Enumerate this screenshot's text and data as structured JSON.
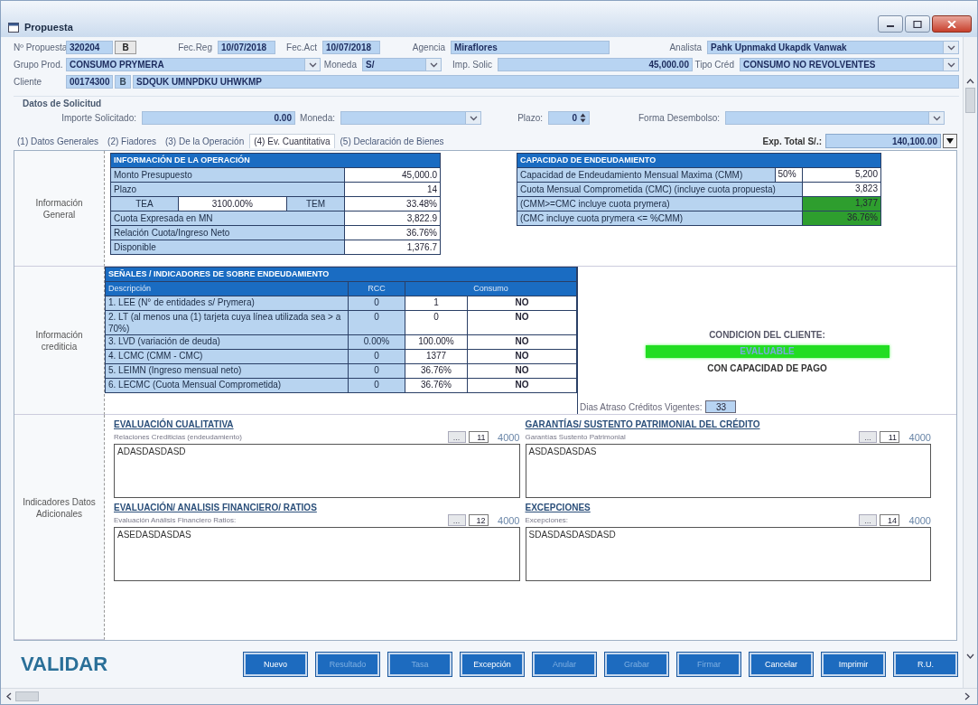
{
  "window": {
    "title": "Propuesta"
  },
  "header_rows": [
    [
      {
        "kind": "label",
        "text": "Nº Propuesta"
      },
      {
        "kind": "field",
        "text": "320204"
      },
      {
        "kind": "button",
        "text": "B"
      },
      {
        "kind": "label",
        "text": "Fec.Reg"
      },
      {
        "kind": "field",
        "text": "10/07/2018"
      },
      {
        "kind": "label",
        "text": "Fec.Act"
      },
      {
        "kind": "field",
        "text": "10/07/2018"
      },
      {
        "kind": "label",
        "text": "Agencia"
      },
      {
        "kind": "field",
        "text": "Miraflores"
      },
      {
        "kind": "label",
        "text": "Analista"
      },
      {
        "kind": "select",
        "text": "Pahk Upnmakd Ukapdk Vanwak"
      }
    ],
    [
      {
        "kind": "label",
        "text": "Grupo Prod."
      },
      {
        "kind": "select",
        "text": "CONSUMO PRYMERA"
      },
      {
        "kind": "label",
        "text": "Moneda"
      },
      {
        "kind": "select",
        "text": "S/"
      },
      {
        "kind": "label",
        "text": "Imp. Solic"
      },
      {
        "kind": "number",
        "text": "45,000.00"
      },
      {
        "kind": "label",
        "text": "Tipo Créd"
      },
      {
        "kind": "select",
        "text": "CONSUMO NO REVOLVENTES"
      }
    ],
    [
      {
        "kind": "label",
        "text": "Cliente"
      },
      {
        "kind": "field",
        "text": "00174300"
      },
      {
        "kind": "button",
        "text": "B"
      },
      {
        "kind": "field",
        "text": "SDQUK UMNPDKU UHWKMP"
      }
    ]
  ],
  "solicitud": {
    "title": "Datos de Solicitud",
    "items": [
      {
        "kind": "label",
        "text": "Importe Solicitado:"
      },
      {
        "kind": "number",
        "text": "0.00"
      },
      {
        "kind": "label",
        "text": "Moneda:"
      },
      {
        "kind": "select"
      },
      {
        "kind": "label",
        "text": "Plazo:"
      },
      {
        "kind": "spinner",
        "text": "0"
      },
      {
        "kind": "label",
        "text": "Forma Desembolso:"
      },
      {
        "kind": "select"
      }
    ]
  },
  "tabs": [
    {
      "label": "(1) Datos Generales",
      "selected": false
    },
    {
      "label": "(2) Fiadores",
      "selected": false
    },
    {
      "label": "(3) De la Operación",
      "selected": false
    },
    {
      "label": "(4) Ev. Cuantitativa",
      "selected": true
    },
    {
      "label": "(5) Declaración de Bienes",
      "selected": false
    }
  ],
  "exp_total": {
    "label": "Exp. Total S/.:",
    "value": "140,100.00"
  },
  "side_labels": [
    "Información General",
    "Información crediticia",
    "Indicadores Datos Adicionales"
  ],
  "operation": {
    "title": "INFORMACIÓN DE LA OPERACIÓN",
    "rows": [
      {
        "kind": "pair",
        "label": "Monto Presupuesto",
        "value": "45,000.0"
      },
      {
        "kind": "pair",
        "label": "Plazo",
        "value": "14"
      },
      {
        "kind": "rate",
        "label": "TEA",
        "input": "3100.00%",
        "label2": "TEM",
        "value": "33.48%"
      },
      {
        "kind": "pair",
        "label": "Cuota Expresada en MN",
        "value": "3,822.9"
      },
      {
        "kind": "pair",
        "label": "Relación Cuota/Ingreso Neto",
        "value": "36.76%"
      },
      {
        "kind": "pair",
        "label": "Disponible",
        "value": "1,376.7"
      }
    ]
  },
  "capacity": {
    "title": "CAPACIDAD DE ENDEUDAMIENTO",
    "rows": [
      {
        "label": "Capacidad de Endeudamiento Mensual Maxima (CMM)",
        "percent": "50%",
        "value": "5,200",
        "color": "#ffffff"
      },
      {
        "label": "Cuota Mensual Comprometida (CMC) (incluye cuota propuesta)",
        "value": "3,823",
        "color": "#ffffff"
      },
      {
        "label": "(CMM>=CMC incluye cuota prymera)",
        "value": "1,377",
        "color": "#2e9e2e"
      },
      {
        "label": "(CMC incluye cuota prymera <= %CMM)",
        "value": "36.76%",
        "color": "#2e9e2e"
      }
    ]
  },
  "signals": {
    "title": "SEÑALES / INDICADORES DE SOBRE ENDEUDAMIENTO",
    "columns": [
      "Descripción",
      "RCC",
      "Consumo"
    ],
    "rows": [
      {
        "description": "1. LEE (N° de entidades s/ Prymera)",
        "rcc": "0",
        "consumo": "1",
        "flag": "NO"
      },
      {
        "description": "2. LT (al menos una (1) tarjeta cuya línea utilizada sea > a 70%)",
        "rcc": "0",
        "consumo": "0",
        "flag": "NO"
      },
      {
        "description": "3. LVD (variación de deuda)",
        "rcc": "0.00%",
        "consumo": "100.00%",
        "flag": "NO"
      },
      {
        "description": "4. LCMC (CMM - CMC)",
        "rcc": "0",
        "consumo": "1377",
        "flag": "NO"
      },
      {
        "description": "5. LEIMN (Ingreso mensual neto)",
        "rcc": "0",
        "consumo": "36.76%",
        "flag": "NO"
      },
      {
        "description": "6. LECMC (Cuota Mensual Comprometida)",
        "rcc": "0",
        "consumo": "36.76%",
        "flag": "NO"
      }
    ]
  },
  "condition": {
    "heading": "CONDICION DEL CLIENTE:",
    "status": "EVALUABLE",
    "note": "CON CAPACIDAD DE PAGO"
  },
  "arrears": {
    "label": "Dias Atraso Créditos Vigentes:",
    "value": "33"
  },
  "notes": [
    {
      "title": "EVALUACIÓN CUALITATIVA",
      "sublabel": "Relaciones Crediticias (endeudamiento)",
      "button": "...",
      "count": "11",
      "max": "4000",
      "text": "ADASDASDASD"
    },
    {
      "title": "GARANTÍAS/ SUSTENTO PATRIMONIAL DEL CRÉDITO",
      "sublabel": "Garantías Sustento Patrimonial",
      "button": "...",
      "count": "11",
      "max": "4000",
      "text": "ASDASDASDAS"
    },
    {
      "title": "EVALUACIÓN/ ANALISIS FINANCIERO/ RATIOS",
      "sublabel": "Evaluación Análisis Financiero Ratios:",
      "button": "...",
      "count": "12",
      "max": "4000",
      "text": "ASEDASDASDAS"
    },
    {
      "title": "EXCEPCIONES",
      "sublabel": "Excepciones:",
      "button": "...",
      "count": "14",
      "max": "4000",
      "text": "SDASDASDASDASD"
    }
  ],
  "validar": "VALIDAR",
  "buttons": [
    {
      "label": "Nuevo",
      "disabled": false
    },
    {
      "label": "Resultado",
      "disabled": true
    },
    {
      "label": "Tasa",
      "disabled": true
    },
    {
      "label": "Excepción",
      "disabled": false
    },
    {
      "label": "Anular",
      "disabled": true
    },
    {
      "label": "Grabar",
      "disabled": true
    },
    {
      "label": "Firmar",
      "disabled": true
    },
    {
      "label": "Cancelar",
      "disabled": false
    },
    {
      "label": "Imprimir",
      "disabled": false
    },
    {
      "label": "R.U.",
      "disabled": false
    }
  ]
}
